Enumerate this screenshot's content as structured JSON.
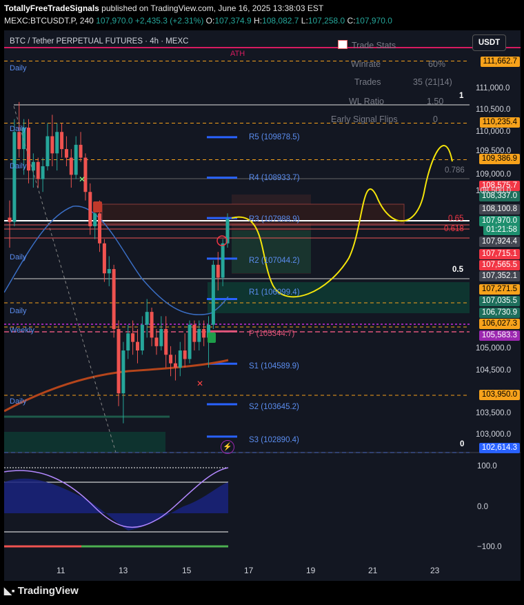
{
  "header": {
    "publisher": "TotallyFreeTradeSignals",
    "published_text": "published on TradingView.com, June 16, 2025 13:38:03 EST",
    "symbol_line": "MEXC:BTCUSDT.P, 240",
    "last": "107,970.0",
    "change": "+2,435.3 (+2.31%)",
    "o": "107,374.9",
    "h": "108,082.7",
    "l": "107,258.0",
    "c": "107,970.0"
  },
  "chart_title": "BTC / Tether PERPETUAL FUTURES · 4h · MEXC",
  "currency_button": "USDT",
  "trade_stats": {
    "title": "Trade Stats",
    "rows": [
      {
        "label": "Winrate",
        "value": "60%"
      },
      {
        "label": "Trades",
        "value": "35 (21|14)"
      },
      {
        "label": "WL Ratio",
        "value": "1.50"
      },
      {
        "label": "Early Signal Flips",
        "value": "0"
      }
    ]
  },
  "annotations": {
    "ath": "ATH",
    "fib_1": "1",
    "fib_0786": "0.786",
    "fib_065": "0.65",
    "fib_0618": "0.618",
    "fib_05": "0.5",
    "fib_0": "0",
    "daily_labels": [
      "Daily",
      "Daily",
      "Daily",
      "Daily",
      "Daily",
      "Daily"
    ],
    "weekly": "Weekly"
  },
  "pivots": [
    {
      "name": "R5",
      "text": "R5 (109878.5)",
      "value": 109878.5
    },
    {
      "name": "R4",
      "text": "R4 (108933.7)",
      "value": 108933.7
    },
    {
      "name": "R3",
      "text": "R3 (107988.9)",
      "value": 107988.9
    },
    {
      "name": "R2",
      "text": "R2 (107044.2)",
      "value": 107044.2
    },
    {
      "name": "R1",
      "text": "R1 (106099.4)",
      "value": 106099.4
    },
    {
      "name": "P",
      "text": "P (105344.7)",
      "value": 105344.7
    },
    {
      "name": "S1",
      "text": "S1 (104589.9)",
      "value": 104589.9
    },
    {
      "name": "S2",
      "text": "S2 (103645.2)",
      "value": 103645.2
    },
    {
      "name": "S3",
      "text": "S3 (102890.4)",
      "value": 102890.4
    }
  ],
  "price_axis_ticks": [
    "111,000.0",
    "110,500.0",
    "110,000.0",
    "109,500.0",
    "109,000.0",
    "108,500.0",
    "105,000.0",
    "104,500.0",
    "103,500.0",
    "103,000.0"
  ],
  "price_labels": [
    {
      "text": "111,662.7",
      "color": "#f7a21b",
      "fg": "#000000"
    },
    {
      "text": "110,235.4",
      "color": "#f7a21b",
      "fg": "#000000"
    },
    {
      "text": "109,386.9",
      "color": "#f7a21b",
      "fg": "#000000"
    },
    {
      "text": "108,575.7",
      "color": "#f23645",
      "fg": "#ffffff"
    },
    {
      "text": "108,337.0",
      "color": "#1e6f5c",
      "fg": "#ffffff"
    },
    {
      "text": "108,100.8",
      "color": "#434651",
      "fg": "#ffffff"
    },
    {
      "text": "107,970.0",
      "color": "#1e8f6e",
      "fg": "#ffffff"
    },
    {
      "text": "01:21:58",
      "color": "#1e8f6e",
      "fg": "#ffffff"
    },
    {
      "text": "107,924.4",
      "color": "#434651",
      "fg": "#ffffff"
    },
    {
      "text": "107,715.1",
      "color": "#f23645",
      "fg": "#ffffff"
    },
    {
      "text": "107,565.5",
      "color": "#f23645",
      "fg": "#ffffff"
    },
    {
      "text": "107,352.1",
      "color": "#434651",
      "fg": "#ffffff"
    },
    {
      "text": "107,271.5",
      "color": "#f7a21b",
      "fg": "#000000"
    },
    {
      "text": "107,035.5",
      "color": "#1e6f5c",
      "fg": "#ffffff"
    },
    {
      "text": "106,730.9",
      "color": "#1e6f5c",
      "fg": "#ffffff"
    },
    {
      "text": "106,027.3",
      "color": "#f7a21b",
      "fg": "#000000"
    },
    {
      "text": "105,583.3",
      "color": "#9c27b0",
      "fg": "#ffffff"
    },
    {
      "text": "103,950.0",
      "color": "#f7a21b",
      "fg": "#000000"
    },
    {
      "text": "102,614.3",
      "color": "#2962ff",
      "fg": "#ffffff"
    }
  ],
  "oscillator_axis": [
    "100.0",
    "0.0",
    "−100.0"
  ],
  "x_axis": [
    "11",
    "13",
    "15",
    "17",
    "19",
    "21",
    "23"
  ],
  "footer": "TradingView",
  "colors": {
    "up": "#26a69a",
    "down": "#ef5350",
    "pivot": "#2962ff",
    "fib": "#f7a21b",
    "projection": "#f5e50a",
    "ema_long": "#b5451b",
    "ema_short": "#3a6ec4"
  },
  "chart_data": {
    "type": "candlestick",
    "title": "BTC / Tether PERPETUAL FUTURES · 4h · MEXC",
    "ylim": [
      102614.3,
      111662.7
    ],
    "candles_ohlc": [
      [
        108000,
        108400,
        107300,
        107900
      ],
      [
        107900,
        110300,
        107800,
        110000
      ],
      [
        110000,
        110700,
        109400,
        109600
      ],
      [
        109600,
        110300,
        109000,
        110100
      ],
      [
        110100,
        110300,
        108800,
        109100
      ],
      [
        109100,
        109500,
        108700,
        109300
      ],
      [
        109300,
        109400,
        108700,
        108900
      ],
      [
        108900,
        109400,
        108600,
        109200
      ],
      [
        109200,
        110200,
        109100,
        109900
      ],
      [
        109900,
        110400,
        109200,
        109500
      ],
      [
        109500,
        110200,
        109100,
        110000
      ],
      [
        110000,
        110200,
        109400,
        109600
      ],
      [
        109600,
        109900,
        109200,
        109400
      ],
      [
        109400,
        109600,
        108700,
        109000
      ],
      [
        109000,
        109900,
        108900,
        109700
      ],
      [
        109700,
        110000,
        109300,
        109400
      ],
      [
        109400,
        109500,
        108400,
        108600
      ],
      [
        108600,
        108800,
        107600,
        107800
      ],
      [
        107800,
        108300,
        107500,
        108100
      ],
      [
        108100,
        108400,
        107200,
        107400
      ],
      [
        107400,
        107500,
        106500,
        106700
      ],
      [
        106700,
        107100,
        106400,
        106800
      ],
      [
        106800,
        106900,
        105200,
        105400
      ],
      [
        105400,
        105600,
        103600,
        103900
      ],
      [
        103900,
        105100,
        103200,
        104900
      ],
      [
        104900,
        105500,
        104700,
        105300
      ],
      [
        105300,
        105600,
        104800,
        105100
      ],
      [
        105100,
        105400,
        104600,
        104900
      ],
      [
        104900,
        105700,
        104800,
        105500
      ],
      [
        105500,
        106100,
        105200,
        105800
      ],
      [
        105800,
        105900,
        105000,
        105200
      ],
      [
        105200,
        105400,
        104800,
        105000
      ],
      [
        105000,
        105700,
        104900,
        105400
      ],
      [
        105400,
        105700,
        104500,
        104800
      ],
      [
        104800,
        105000,
        104300,
        104600
      ],
      [
        104600,
        104800,
        104200,
        104500
      ],
      [
        104500,
        105100,
        104300,
        104900
      ],
      [
        104900,
        105300,
        104500,
        104700
      ],
      [
        104700,
        105600,
        104600,
        105500
      ],
      [
        105500,
        105600,
        104900,
        105100
      ],
      [
        105100,
        105600,
        104900,
        105400
      ],
      [
        105400,
        105600,
        105000,
        105200
      ],
      [
        105200,
        105700,
        104500,
        105500
      ],
      [
        105500,
        107000,
        105400,
        106900
      ],
      [
        106900,
        107200,
        106300,
        106600
      ],
      [
        106600,
        107500,
        106400,
        107400
      ],
      [
        107400,
        108100,
        107300,
        107970
      ]
    ]
  }
}
